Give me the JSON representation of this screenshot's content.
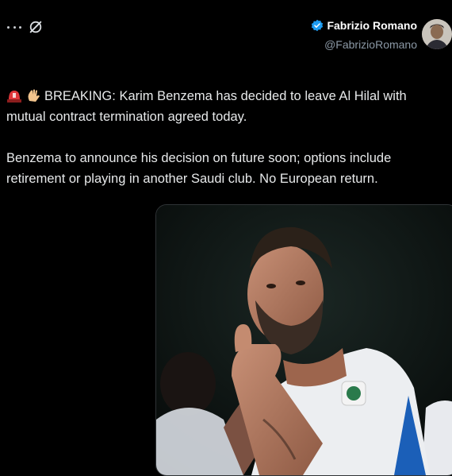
{
  "toolbar": {
    "more_icon": "more-icon",
    "grok_icon": "grok-icon"
  },
  "author": {
    "name": "Fabrizio Romano",
    "handle": "@FabrizioRomano",
    "verified": true,
    "verified_color": "#1d9bf0",
    "avatar_icon": "avatar"
  },
  "tweet": {
    "emojis": [
      "rotating-light-emoji",
      "waving-hand-emoji"
    ],
    "line1": "BREAKING: Karim Benzema has decided to leave Al Hilal with mutual contract termination agreed today.",
    "line2": "Benzema to announce his decision on future soon; options include retirement or playing in another Saudi club. No European return."
  },
  "media": {
    "description_icon": "photo-benzema-thumbs-up"
  },
  "colors": {
    "background": "#000000",
    "text": "#e7e9ea",
    "muted": "#8b98a5",
    "accent": "#1d9bf0"
  }
}
